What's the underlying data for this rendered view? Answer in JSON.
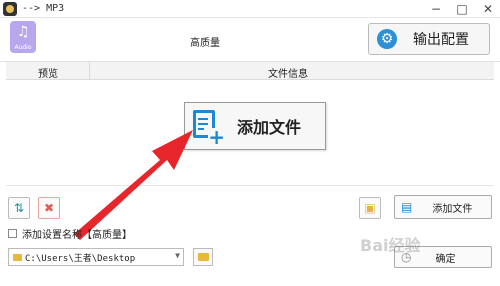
{
  "window": {
    "title": "--> MP3"
  },
  "header": {
    "audio_label": "Audio",
    "quality": "高质量",
    "output_button": "输出配置"
  },
  "columns": {
    "preview": "预览",
    "file_info": "文件信息"
  },
  "center_button": {
    "label": "添加文件"
  },
  "bottom": {
    "add_file_button": "添加文件",
    "checkbox_label": "添加设置名称【高质量】",
    "path_value": "C:\\Users\\王者\\Desktop",
    "confirm_button": "确定",
    "watermark": "Bai经验"
  },
  "colors": {
    "accent_blue": "#1a88d4",
    "arrow_red": "#e6262b",
    "audio_purple": "#b9a7ee"
  },
  "icons": [
    "app-icon",
    "music-note-icon",
    "gear-icon",
    "add-file-icon",
    "sort-icon",
    "clear-icon",
    "folder-add-icon",
    "folder-icon",
    "confirm-icon"
  ]
}
